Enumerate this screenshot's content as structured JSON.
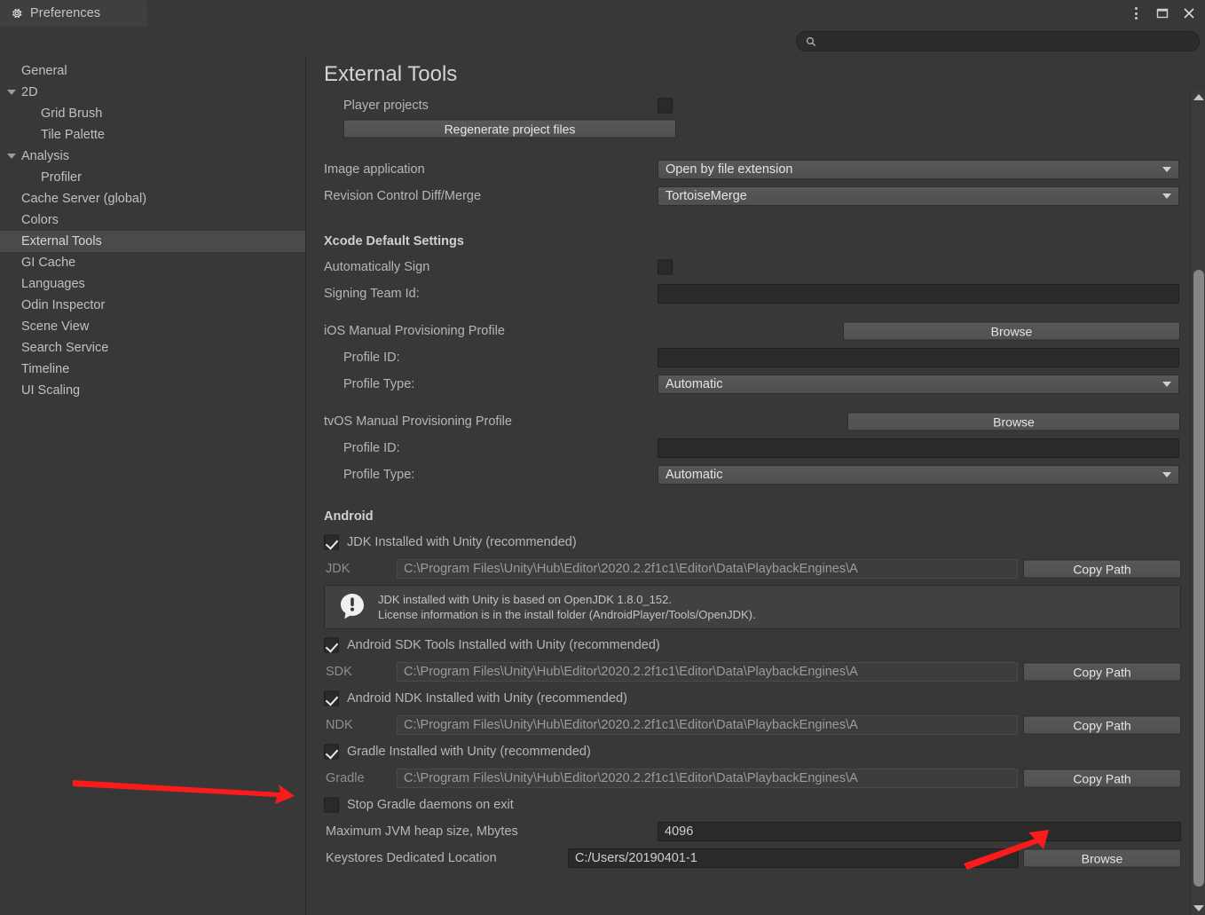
{
  "window": {
    "tab_title": "Preferences",
    "tab_icon": "gear-icon",
    "controls": {
      "menu": "kebab-menu-icon",
      "maximize": "maximize-icon",
      "close": "close-icon"
    }
  },
  "search": {
    "icon": "search-icon",
    "value": "",
    "placeholder": ""
  },
  "sidebar": {
    "items": [
      {
        "label": "General",
        "indent": 0,
        "expandable": false,
        "selected": false
      },
      {
        "label": "2D",
        "indent": 0,
        "expandable": true,
        "selected": false
      },
      {
        "label": "Grid Brush",
        "indent": 1,
        "expandable": false,
        "selected": false
      },
      {
        "label": "Tile Palette",
        "indent": 1,
        "expandable": false,
        "selected": false
      },
      {
        "label": "Analysis",
        "indent": 0,
        "expandable": true,
        "selected": false
      },
      {
        "label": "Profiler",
        "indent": 1,
        "expandable": false,
        "selected": false
      },
      {
        "label": "Cache Server (global)",
        "indent": 0,
        "expandable": false,
        "selected": false
      },
      {
        "label": "Colors",
        "indent": 0,
        "expandable": false,
        "selected": false
      },
      {
        "label": "External Tools",
        "indent": 0,
        "expandable": false,
        "selected": true
      },
      {
        "label": "GI Cache",
        "indent": 0,
        "expandable": false,
        "selected": false
      },
      {
        "label": "Languages",
        "indent": 0,
        "expandable": false,
        "selected": false
      },
      {
        "label": "Odin Inspector",
        "indent": 0,
        "expandable": false,
        "selected": false
      },
      {
        "label": "Scene View",
        "indent": 0,
        "expandable": false,
        "selected": false
      },
      {
        "label": "Search Service",
        "indent": 0,
        "expandable": false,
        "selected": false
      },
      {
        "label": "Timeline",
        "indent": 0,
        "expandable": false,
        "selected": false
      },
      {
        "label": "UI Scaling",
        "indent": 0,
        "expandable": false,
        "selected": false
      }
    ]
  },
  "main": {
    "title": "External Tools",
    "player_projects": {
      "label": "Player projects",
      "checked": false
    },
    "regenerate_button": "Regenerate project files",
    "image_application": {
      "label": "Image application",
      "value": "Open by file extension"
    },
    "revision_control": {
      "label": "Revision Control Diff/Merge",
      "value": "TortoiseMerge"
    },
    "xcode": {
      "header": "Xcode Default Settings",
      "automatically_sign": {
        "label": "Automatically Sign",
        "checked": false
      },
      "signing_team_id": {
        "label": "Signing Team Id:",
        "value": ""
      },
      "ios": {
        "label": "iOS Manual Provisioning Profile",
        "browse": "Browse",
        "profile_id": {
          "label": "Profile ID:",
          "value": ""
        },
        "profile_type": {
          "label": "Profile Type:",
          "value": "Automatic"
        }
      },
      "tvos": {
        "label": "tvOS Manual Provisioning Profile",
        "browse": "Browse",
        "profile_id": {
          "label": "Profile ID:",
          "value": ""
        },
        "profile_type": {
          "label": "Profile Type:",
          "value": "Automatic"
        }
      }
    },
    "android": {
      "header": "Android",
      "jdk_installed": {
        "label": "JDK Installed with Unity (recommended)",
        "checked": true
      },
      "jdk_path": {
        "label": "JDK",
        "value": "C:\\Program Files\\Unity\\Hub\\Editor\\2020.2.2f1c1\\Editor\\Data\\PlaybackEngines\\A",
        "copy_button": "Copy Path"
      },
      "jdk_help": {
        "icon": "info-exclamation-icon",
        "line1": "JDK installed with Unity is based on OpenJDK 1.8.0_152.",
        "line2": "License information is in the install folder (AndroidPlayer/Tools/OpenJDK)."
      },
      "sdk_installed": {
        "label": "Android SDK Tools Installed with Unity (recommended)",
        "checked": true
      },
      "sdk_path": {
        "label": "SDK",
        "value": "C:\\Program Files\\Unity\\Hub\\Editor\\2020.2.2f1c1\\Editor\\Data\\PlaybackEngines\\A",
        "copy_button": "Copy Path"
      },
      "ndk_installed": {
        "label": "Android NDK Installed with Unity (recommended)",
        "checked": true
      },
      "ndk_path": {
        "label": "NDK",
        "value": "C:\\Program Files\\Unity\\Hub\\Editor\\2020.2.2f1c1\\Editor\\Data\\PlaybackEngines\\A",
        "copy_button": "Copy Path"
      },
      "gradle_installed": {
        "label": "Gradle Installed with Unity (recommended)",
        "checked": true
      },
      "gradle_path": {
        "label": "Gradle",
        "value": "C:\\Program Files\\Unity\\Hub\\Editor\\2020.2.2f1c1\\Editor\\Data\\PlaybackEngines\\A",
        "copy_button": "Copy Path"
      },
      "stop_gradle": {
        "label": "Stop Gradle daemons on exit",
        "checked": false
      },
      "jvm_heap": {
        "label": "Maximum JVM heap size, Mbytes",
        "value": "4096"
      },
      "keystores": {
        "label": "Keystores Dedicated Location",
        "value": "C:/Users/20190401-1",
        "browse": "Browse"
      }
    }
  },
  "scrollbar": {
    "up": "scroll-up-arrow-icon",
    "down": "scroll-down-arrow-icon"
  },
  "annotations": {
    "color": "#fb1b1b",
    "arrow1": {
      "name": "arrow-pointing-to-gradle-checkbox"
    },
    "arrow2": {
      "name": "arrow-pointing-to-gradle-copy-path"
    }
  }
}
